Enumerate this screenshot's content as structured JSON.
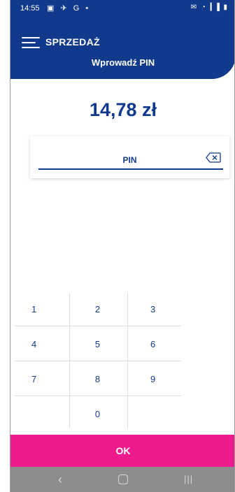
{
  "status_bar": {
    "time": "14:55",
    "left_icons": "▣ ✈ G •",
    "right_icons": "✉ ◔ ▎▌▮"
  },
  "header": {
    "title": "SPRZEDAŻ",
    "subtitle": "Wprowadź PIN",
    "background_color": "#123a8c"
  },
  "amount": "14,78 zł",
  "pin": {
    "label": "PIN"
  },
  "keypad": {
    "keys": [
      "1",
      "2",
      "3",
      "4",
      "5",
      "6",
      "7",
      "8",
      "9",
      "0"
    ]
  },
  "ok_button": {
    "label": "OK",
    "color": "#ee1b8f"
  },
  "nav_bar": {
    "back": "‹",
    "recent": "|||"
  }
}
